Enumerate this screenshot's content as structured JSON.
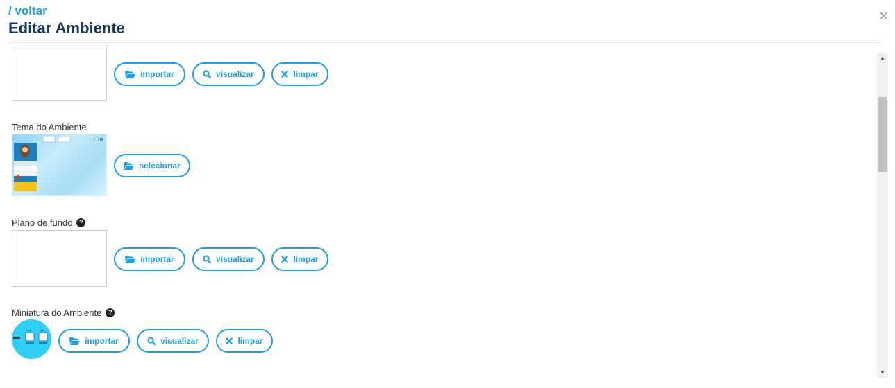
{
  "header": {
    "back_label": "/ voltar",
    "title": "Editar Ambiente",
    "close_symbol": "×"
  },
  "sections": {
    "top_image": {
      "buttons": {
        "import": "importar",
        "view": "visualizar",
        "clear": "limpar"
      }
    },
    "theme": {
      "label": "Tema do Ambiente",
      "buttons": {
        "select": "selecionar"
      }
    },
    "background": {
      "label": "Plano de fundo",
      "buttons": {
        "import": "importar",
        "view": "visualizar",
        "clear": "limpar"
      }
    },
    "thumbnail": {
      "label": "Miniatura do Ambiente",
      "buttons": {
        "import": "importar",
        "view": "visualizar",
        "clear": "limpar"
      }
    }
  },
  "icons": {
    "folder": "folder-open-icon",
    "search": "search-icon",
    "clear": "times-icon",
    "help": "question-circle-icon",
    "close": "close-icon"
  },
  "colors": {
    "accent": "#1aa0e6",
    "title": "#17375e",
    "help_icon": "#222222",
    "thumbnail_bg": "#2fd0f5"
  }
}
